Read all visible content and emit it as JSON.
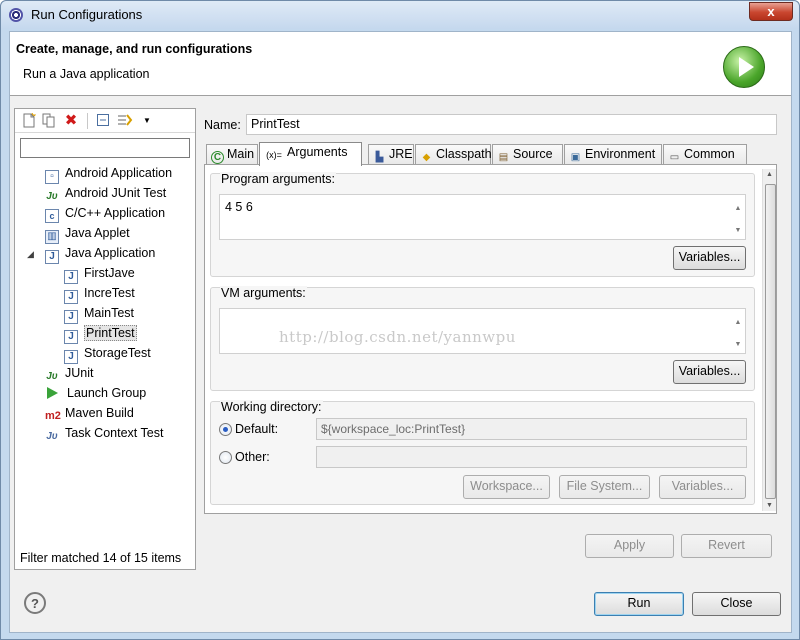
{
  "window": {
    "title": "Run Configurations",
    "close_label": "x"
  },
  "header": {
    "title": "Create, manage, and run configurations",
    "description": "Run a Java application",
    "icon": "run-icon"
  },
  "left_panel": {
    "toolbar": [
      {
        "icon": "new-config-icon"
      },
      {
        "icon": "duplicate-icon"
      },
      {
        "icon": "delete-icon"
      },
      {
        "icon": "collapse-all-icon"
      },
      {
        "icon": "filter-icon"
      }
    ],
    "filter_value": "",
    "tree": [
      {
        "label": "Android Application",
        "icon": "android-app-icon"
      },
      {
        "label": "Android JUnit Test",
        "icon": "junit-icon"
      },
      {
        "label": "C/C++ Application",
        "icon": "c-app-icon"
      },
      {
        "label": "Java Applet",
        "icon": "applet-icon"
      },
      {
        "label": "Java Application",
        "icon": "java-app-icon",
        "expanded": true
      },
      {
        "label": "FirstJave",
        "icon": "java-file-icon"
      },
      {
        "label": "IncreTest",
        "icon": "java-file-icon"
      },
      {
        "label": "MainTest",
        "icon": "java-file-icon"
      },
      {
        "label": "PrintTest",
        "icon": "java-file-icon",
        "selected": true
      },
      {
        "label": "StorageTest",
        "icon": "java-file-icon"
      },
      {
        "label": "JUnit",
        "icon": "junit-icon"
      },
      {
        "label": "Launch Group",
        "icon": "launch-group-icon"
      },
      {
        "label": "Maven Build",
        "icon": "maven-icon"
      },
      {
        "label": "Task Context Test",
        "icon": "task-test-icon"
      }
    ],
    "filter_status": "Filter matched 14 of 15 items"
  },
  "config": {
    "name_label": "Name:",
    "name_value": "PrintTest",
    "tabs": [
      {
        "label": "Main",
        "glyph": "C",
        "icon": "main-tab-icon"
      },
      {
        "label": "Arguments",
        "glyph": "(x)=",
        "icon": "arguments-tab-icon",
        "active": true
      },
      {
        "label": "JRE",
        "glyph": "▙",
        "icon": "jre-tab-icon"
      },
      {
        "label": "Classpath",
        "glyph": "◆",
        "icon": "classpath-tab-icon"
      },
      {
        "label": "Source",
        "glyph": "▤",
        "icon": "source-tab-icon"
      },
      {
        "label": "Environment",
        "glyph": "▣",
        "icon": "environment-tab-icon"
      },
      {
        "label": "Common",
        "glyph": "▭",
        "icon": "common-tab-icon"
      }
    ],
    "program_args": {
      "title": "Program arguments:",
      "value": "4 5 6",
      "variables_label": "Variables..."
    },
    "vm_args": {
      "title": "VM arguments:",
      "value": "",
      "variables_label": "Variables..."
    },
    "watermark": "http://blog.csdn.net/yannwpu",
    "working_dir": {
      "title": "Working directory:",
      "default_label": "Default:",
      "default_value": "${workspace_loc:PrintTest}",
      "other_label": "Other:",
      "other_value": "",
      "selected": "default",
      "workspace_label": "Workspace...",
      "filesystem_label": "File System...",
      "variables_label": "Variables..."
    },
    "apply_label": "Apply",
    "revert_label": "Revert"
  },
  "footer": {
    "help_label": "?",
    "run_label": "Run",
    "close_label": "Close"
  }
}
